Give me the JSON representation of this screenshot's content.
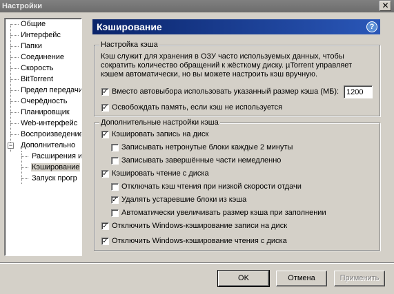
{
  "window": {
    "title": "Настройки"
  },
  "tree": {
    "items": [
      {
        "label": "Общие"
      },
      {
        "label": "Интерфейс"
      },
      {
        "label": "Папки"
      },
      {
        "label": "Соединение"
      },
      {
        "label": "Скорость"
      },
      {
        "label": "BitTorrent"
      },
      {
        "label": "Предел передачи"
      },
      {
        "label": "Очерёдность"
      },
      {
        "label": "Планировщик"
      },
      {
        "label": "Web-интерфейс"
      },
      {
        "label": "Воспроизведение"
      },
      {
        "label": "Дополнительно"
      },
      {
        "label": "Расширения и"
      },
      {
        "label": "Кэширование"
      },
      {
        "label": "Запуск прогр"
      }
    ],
    "selected": "Кэширование"
  },
  "page": {
    "title": "Кэширование",
    "help_icon": "?"
  },
  "cache_group": {
    "legend": "Настройка кэша",
    "description_lines": [
      "Кэш служит для хранения в ОЗУ часто используемых данных, чтобы",
      "сократить количество обращений к жёсткому диску. µTorrent управляет",
      "кэшем автоматически, но вы можете настроить кэш вручную."
    ],
    "override_size_label": "Вместо автовыбора использовать указанный размер кэша (МБ):",
    "override_size_checked": true,
    "cache_size_value": "1200",
    "free_memory_label": "Освобождать память, если кэш не используется",
    "free_memory_checked": true
  },
  "advanced_group": {
    "legend": "Дополнительные настройки кэша",
    "options": [
      {
        "label": "Кэшировать запись на диск",
        "checked": true
      },
      {
        "label": "Записывать нетронутые блоки каждые 2 минуты",
        "checked": false
      },
      {
        "label": "Записывать завершённые части немедленно",
        "checked": false
      },
      {
        "label": "Кэшировать чтение с диска",
        "checked": true
      },
      {
        "label": "Отключать кэш чтения при низкой скорости отдачи",
        "checked": false
      },
      {
        "label": "Удалять устаревшие блоки из кэша",
        "checked": true
      },
      {
        "label": "Автоматически увеличивать размер кэша при заполнении",
        "checked": false
      },
      {
        "label": "Отключить Windows-кэширование записи на диск",
        "checked": true
      },
      {
        "label": "Отключить Windows-кэширование чтения с диска",
        "checked": true
      }
    ]
  },
  "buttons": {
    "ok": "OK",
    "cancel": "Отмена",
    "apply": "Применить"
  },
  "check_mark": "✓",
  "close_glyph": "✕"
}
